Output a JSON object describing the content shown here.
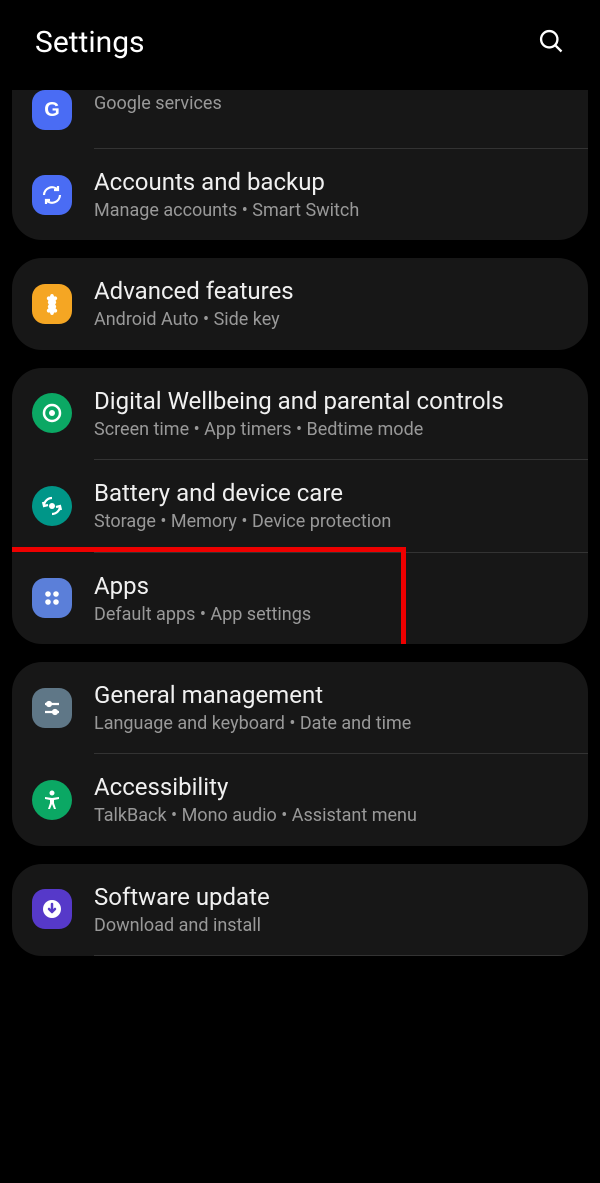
{
  "header": {
    "title": "Settings"
  },
  "groups": [
    {
      "items": [
        {
          "title": "Google",
          "subtitle": "Google services",
          "partial": true
        },
        {
          "title": "Accounts and backup",
          "subtitle": "Manage accounts  •  Smart Switch"
        }
      ]
    },
    {
      "items": [
        {
          "title": "Advanced features",
          "subtitle": "Android Auto  •  Side key"
        }
      ]
    },
    {
      "items": [
        {
          "title": "Digital Wellbeing and parental controls",
          "subtitle": "Screen time  •  App timers  •  Bedtime mode"
        },
        {
          "title": "Battery and device care",
          "subtitle": "Storage  •  Memory  •  Device protection"
        },
        {
          "title": "Apps",
          "subtitle": "Default apps  •  App settings",
          "highlighted": true
        }
      ]
    },
    {
      "items": [
        {
          "title": "General management",
          "subtitle": "Language and keyboard  •  Date and time"
        },
        {
          "title": "Accessibility",
          "subtitle": "TalkBack  •  Mono audio  •  Assistant menu"
        }
      ]
    },
    {
      "items": [
        {
          "title": "Software update",
          "subtitle": "Download and install"
        }
      ]
    }
  ]
}
